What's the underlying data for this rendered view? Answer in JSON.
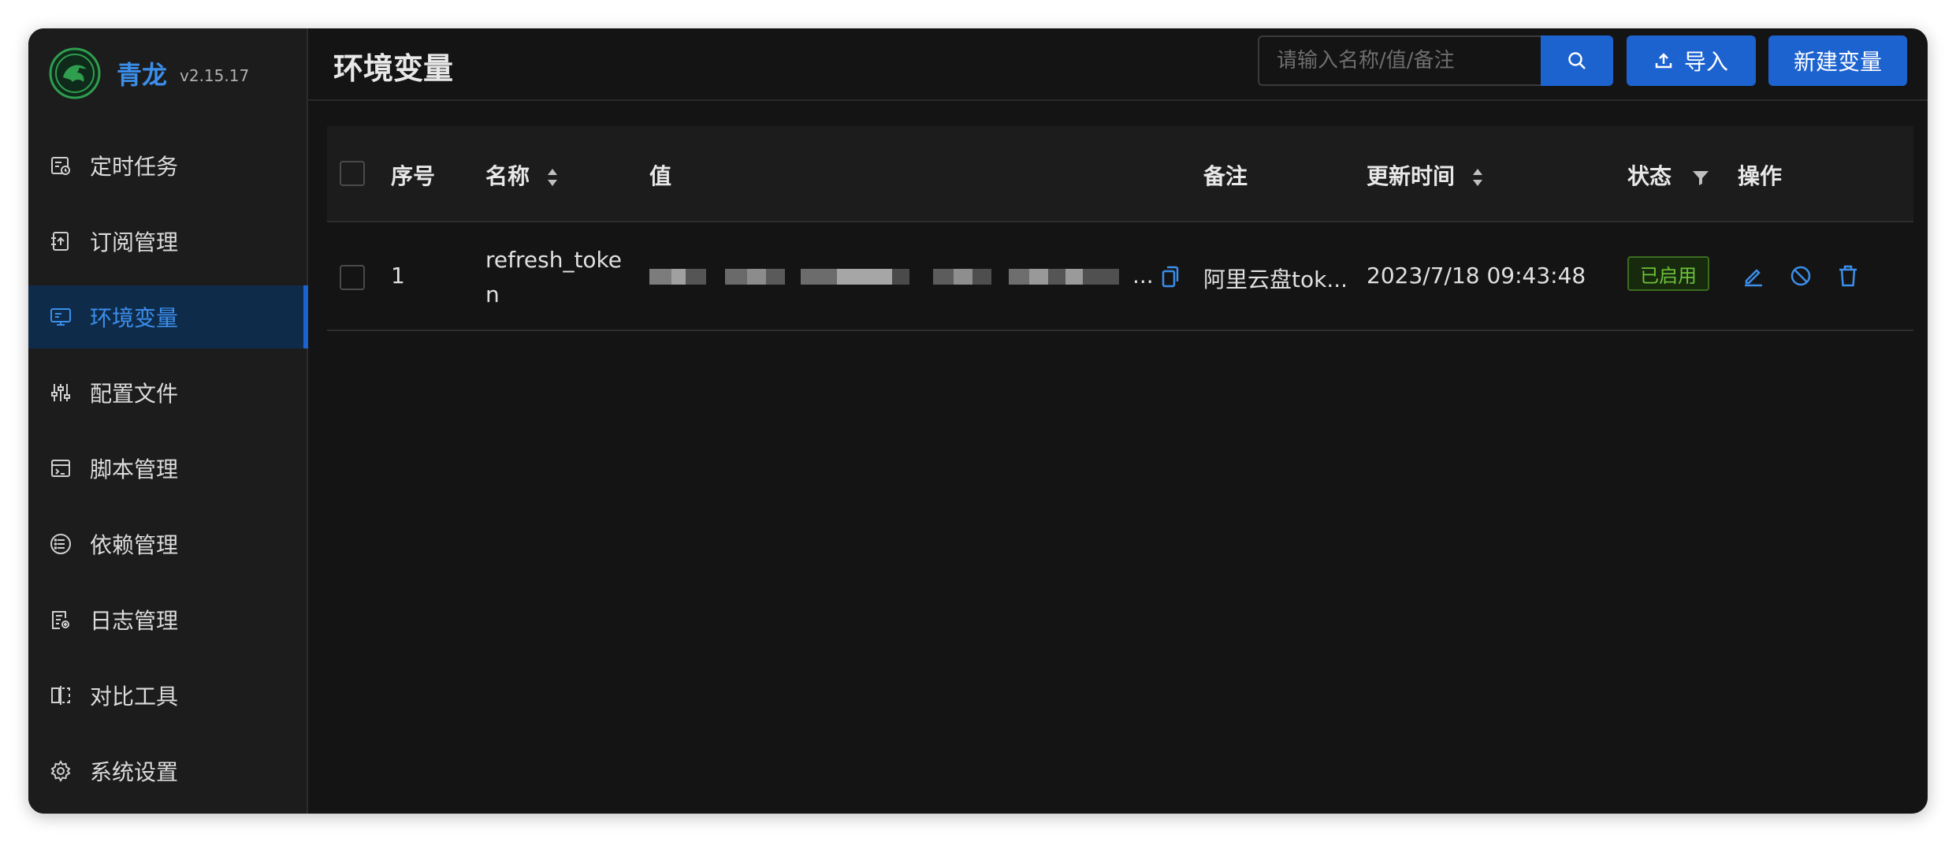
{
  "app": {
    "name": "青龙",
    "version": "v2.15.17"
  },
  "sidebar": {
    "items": [
      {
        "label": "定时任务",
        "icon": "schedule-icon",
        "active": false
      },
      {
        "label": "订阅管理",
        "icon": "subscription-icon",
        "active": false
      },
      {
        "label": "环境变量",
        "icon": "environment-icon",
        "active": true
      },
      {
        "label": "配置文件",
        "icon": "sliders-icon",
        "active": false
      },
      {
        "label": "脚本管理",
        "icon": "script-icon",
        "active": false
      },
      {
        "label": "依赖管理",
        "icon": "list-icon",
        "active": false
      },
      {
        "label": "日志管理",
        "icon": "log-icon",
        "active": false
      },
      {
        "label": "对比工具",
        "icon": "diff-icon",
        "active": false
      },
      {
        "label": "系统设置",
        "icon": "gear-icon",
        "active": false
      }
    ]
  },
  "header": {
    "title": "环境变量",
    "search_placeholder": "请输入名称/值/备注",
    "search_value": "",
    "import_label": "导入",
    "new_label": "新建变量"
  },
  "table": {
    "columns": {
      "index": "序号",
      "name": "名称",
      "value": "值",
      "remark": "备注",
      "updated": "更新时间",
      "status": "状态",
      "actions": "操作"
    },
    "rows": [
      {
        "index": "1",
        "name": "refresh_token",
        "value_redacted": true,
        "value_ellipsis": "...",
        "remark": "阿里云盘tok...",
        "updated": "2023/7/18 09:43:48",
        "status": "已启用"
      }
    ]
  },
  "colors": {
    "accent": "#1d63d0",
    "link": "#3b8eea",
    "enabled_text": "#6cc03a",
    "background": "#141414",
    "sidebar": "#1c1c1c"
  }
}
